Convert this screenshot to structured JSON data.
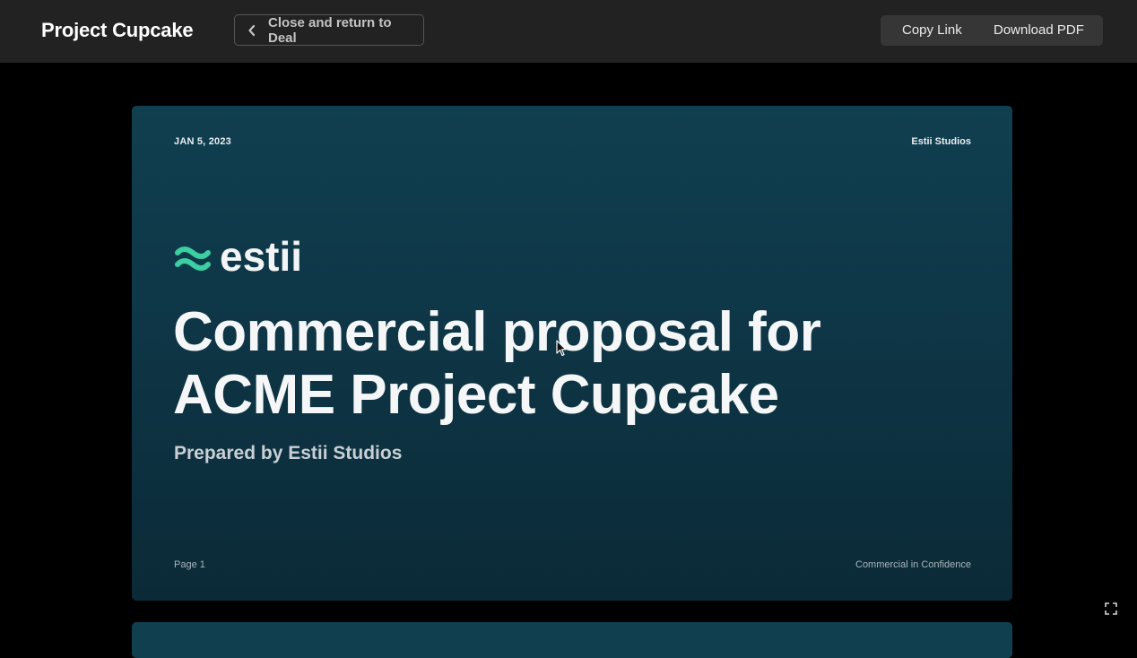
{
  "header": {
    "title": "Project Cupcake",
    "back_label": "Close and return to Deal",
    "copy_link_label": "Copy Link",
    "download_pdf_label": "Download PDF"
  },
  "slide": {
    "date": "JAN 5, 2023",
    "company": "Estii Studios",
    "logo_text": "estii",
    "headline_line1": "Commercial proposal for",
    "headline_line2": "ACME Project Cupcake",
    "subtitle": "Prepared by Estii Studios",
    "page_label": "Page 1",
    "confidentiality": "Commercial in Confidence"
  },
  "colors": {
    "accent": "#3ccfa2",
    "slide_bg": "#0f3a4a",
    "topbar_bg": "#222222"
  },
  "icons": {
    "back": "chevron-left-icon",
    "logo": "estii-wave-logo",
    "fullscreen": "fullscreen-icon"
  }
}
